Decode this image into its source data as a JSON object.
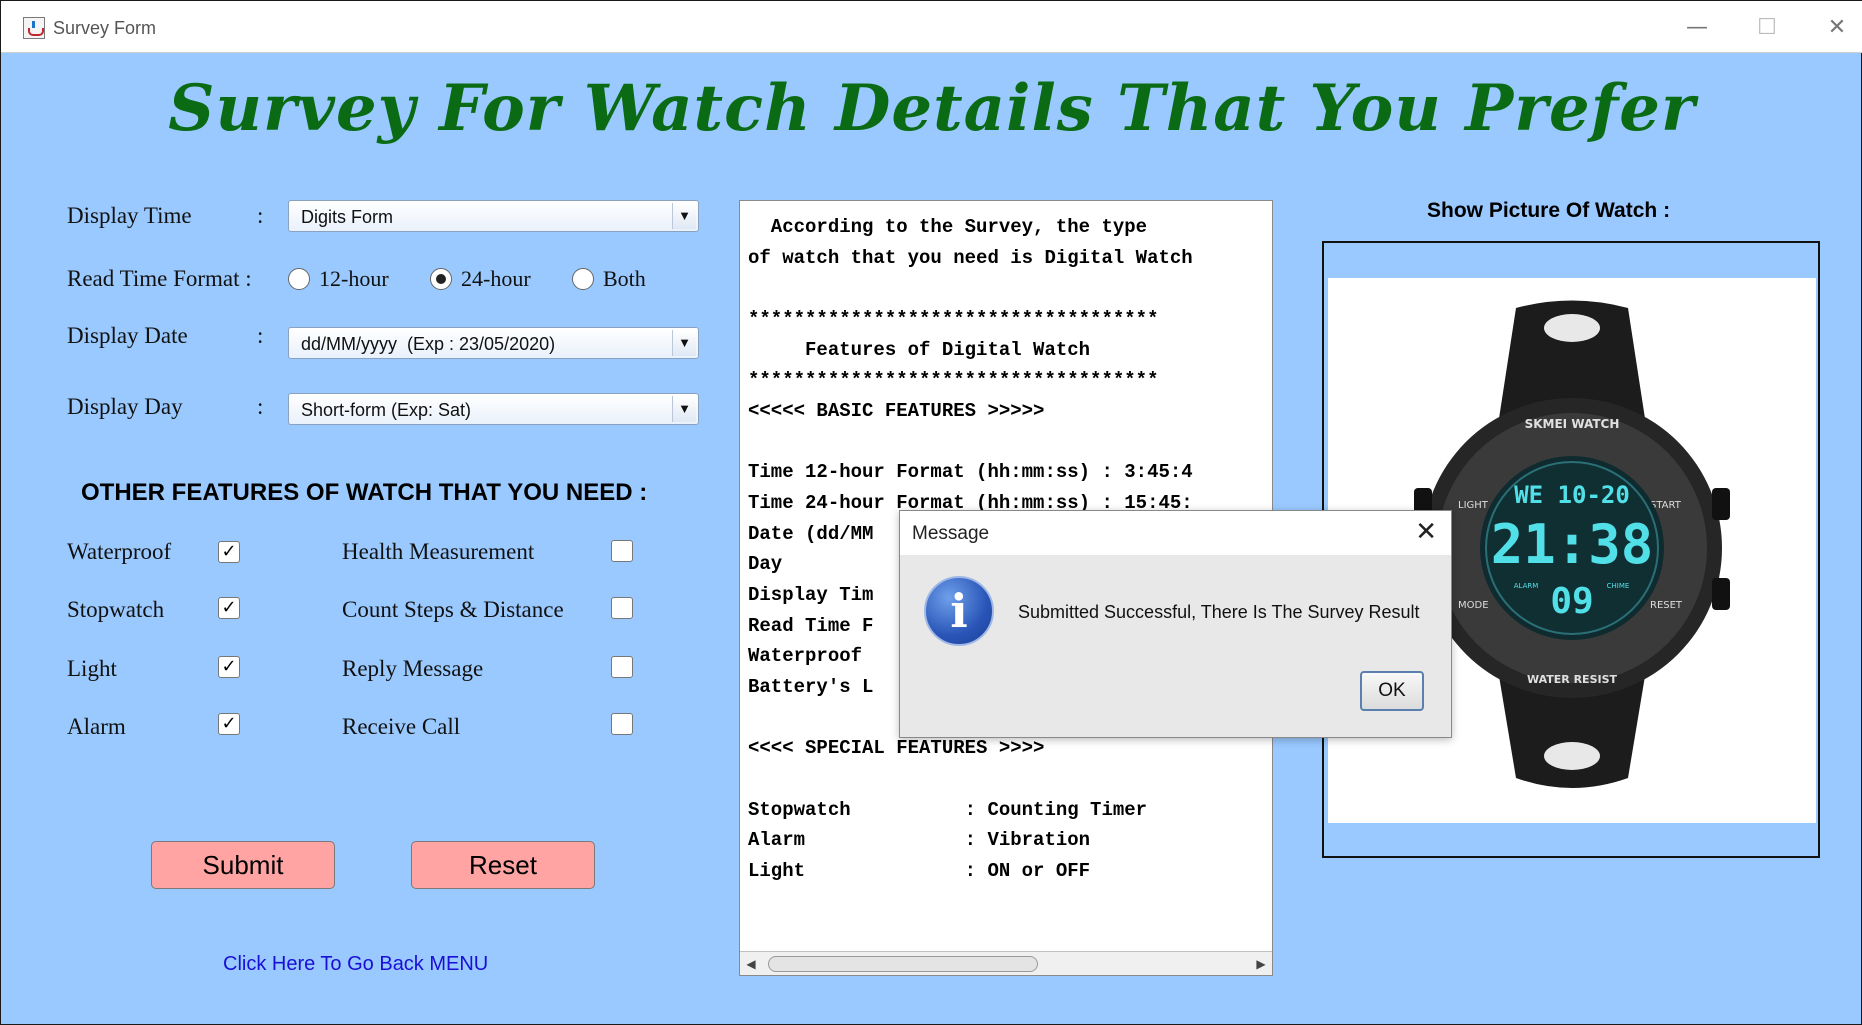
{
  "window": {
    "title": "Survey Form",
    "minimize_glyph": "—",
    "maximize_glyph": "☐",
    "close_glyph": "✕"
  },
  "heading": "Survey For Watch Details That You Prefer",
  "form": {
    "display_time": {
      "label": "Display Time",
      "colon": ":",
      "value": "Digits Form"
    },
    "read_time_format": {
      "label": "Read Time Format :",
      "options": [
        "12-hour",
        "24-hour",
        "Both"
      ],
      "selected": "24-hour"
    },
    "display_date": {
      "label": "Display Date",
      "colon": ":",
      "value": "dd/MM/yyyy  (Exp : 23/05/2020)"
    },
    "display_day": {
      "label": "Display Day",
      "colon": ":",
      "value": "Short-form (Exp: Sat)"
    },
    "dropdown_arrow": "▼"
  },
  "features": {
    "title": "OTHER FEATURES OF WATCH THAT YOU NEED :",
    "left": [
      {
        "label": "Waterproof",
        "checked": true
      },
      {
        "label": "Stopwatch",
        "checked": true
      },
      {
        "label": "Light",
        "checked": true
      },
      {
        "label": "Alarm",
        "checked": true
      }
    ],
    "right": [
      {
        "label": "Health Measurement",
        "checked": false
      },
      {
        "label": "Count Steps & Distance",
        "checked": false
      },
      {
        "label": "Reply Message",
        "checked": false
      },
      {
        "label": "Receive Call",
        "checked": false
      }
    ],
    "check_glyph": "✓"
  },
  "buttons": {
    "submit": "Submit",
    "reset": "Reset"
  },
  "back_link": "Click Here To Go Back MENU",
  "result": {
    "lines": [
      "  According to the Survey, the type",
      "of watch that you need is Digital Watch",
      "",
      "************************************",
      "     Features of Digital Watch",
      "************************************",
      "<<<<< BASIC FEATURES >>>>>",
      "",
      "Time 12-hour Format (hh:mm:ss) : 3:45:4",
      "Time 24-hour Format (hh:mm:ss) : 15:45:",
      "Date (dd/MM",
      "Day",
      "Display Tim",
      "Read Time F",
      "Waterproof ",
      "Battery's L",
      "",
      "<<<< SPECIAL FEATURES >>>>",
      "",
      "Stopwatch          : Counting Timer",
      "Alarm              : Vibration",
      "Light              : ON or OFF"
    ],
    "scroll_left": "◀",
    "scroll_right": "▶"
  },
  "picture": {
    "label": "Show Picture Of Watch :",
    "watch": {
      "brand": "SKMEI WATCH",
      "day_date": "WE 10-20",
      "time": "21:38",
      "seconds": "09",
      "labels": [
        "LIGHT",
        "START",
        "MODE",
        "RESET",
        "ALARM",
        "CHIME",
        "WATER RESIST"
      ]
    }
  },
  "dialog": {
    "title": "Message",
    "close": "✕",
    "icon": "i",
    "message": "Submitted Successful, There Is The Survey Result",
    "ok": "OK"
  }
}
